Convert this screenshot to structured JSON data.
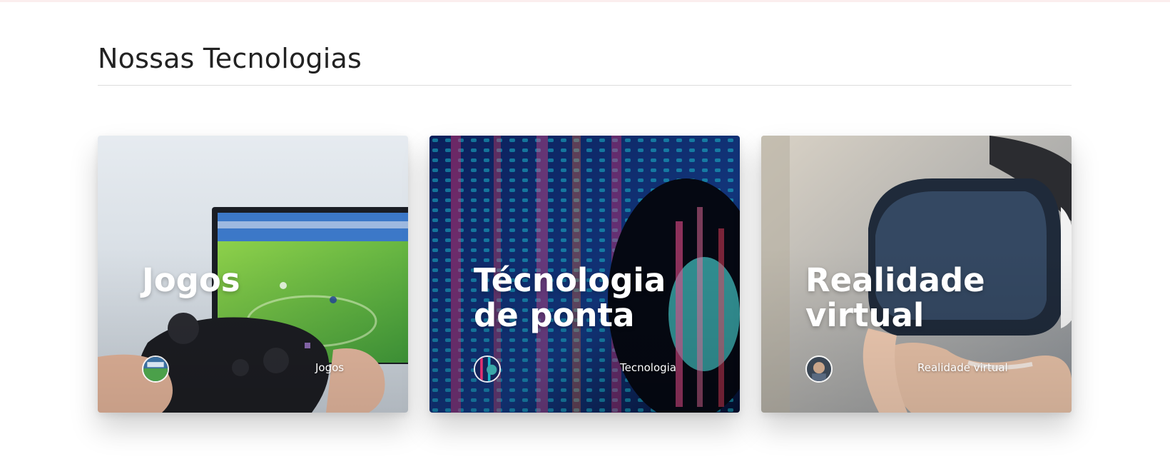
{
  "section": {
    "title": "Nossas Tecnologias"
  },
  "cards": [
    {
      "title": [
        "Jogos"
      ],
      "category": "Jogos",
      "image_icon": "game-controller-tv",
      "avatar_icon": "stadium-thumbnail"
    },
    {
      "title": [
        "Técnologia",
        "de ponta"
      ],
      "category": "Tecnologia",
      "image_icon": "woman-digital-code",
      "avatar_icon": "digital-portrait-thumbnail"
    },
    {
      "title": [
        "Realidade",
        "virtual"
      ],
      "category": "Realidade virtual",
      "image_icon": "vr-headset",
      "avatar_icon": "person-thumbnail"
    }
  ],
  "colors": {
    "title_text": "#222222",
    "card_text": "#ffffff",
    "divider": "#dcdcdc"
  }
}
